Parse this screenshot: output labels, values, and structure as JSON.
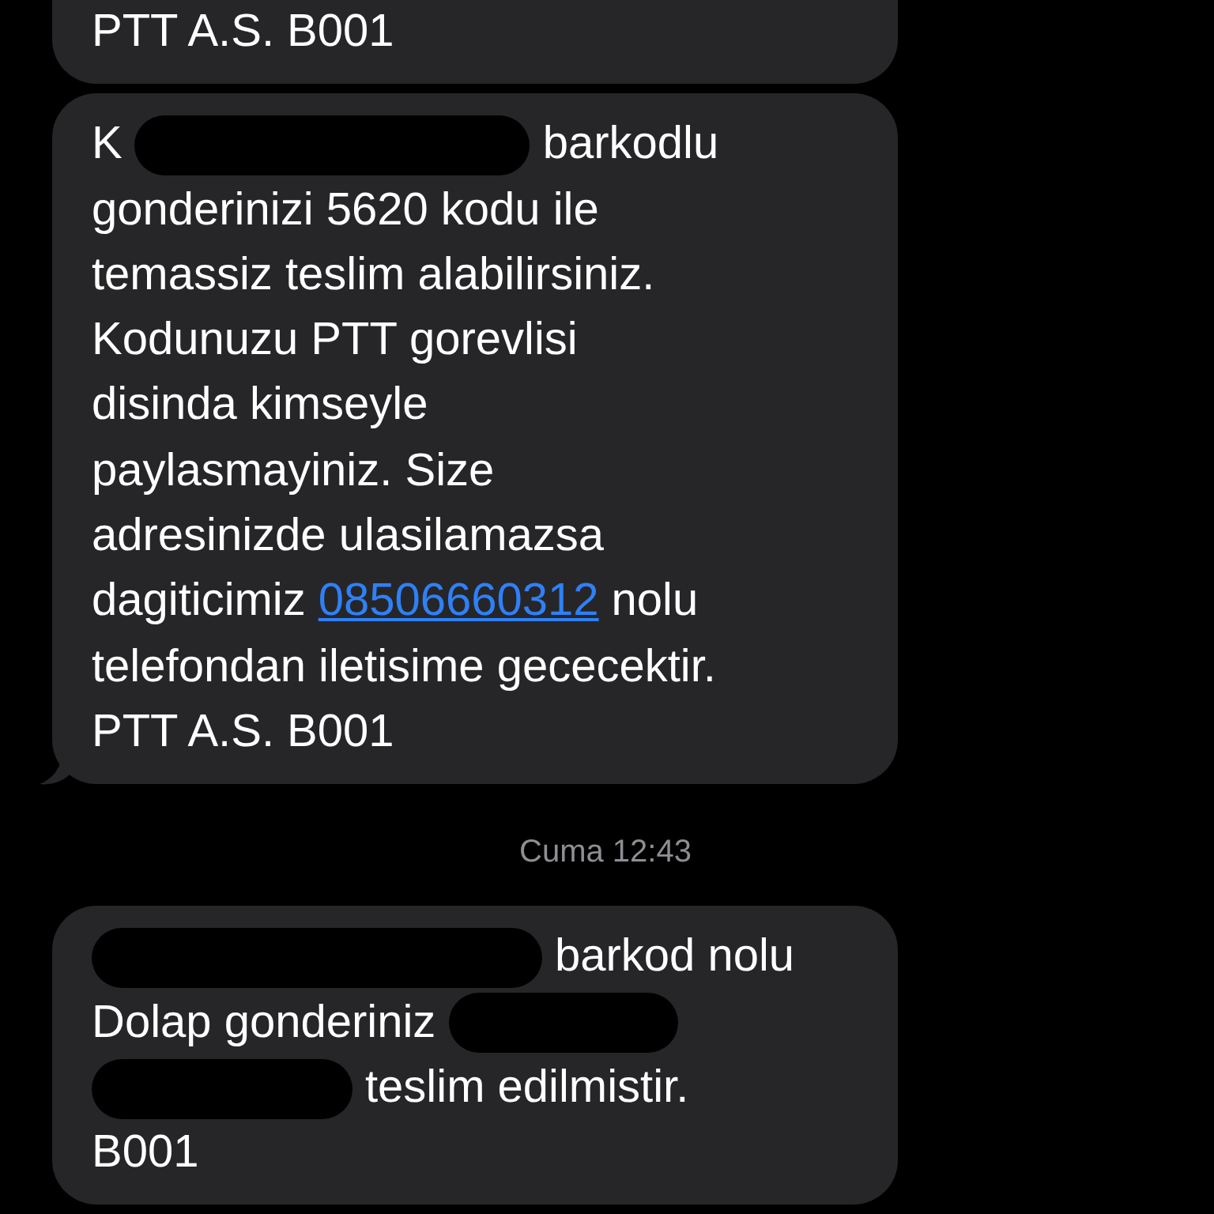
{
  "items": [
    {
      "kind": "message",
      "tail": false,
      "lines": [
        [
          {
            "kind": "text",
            "text": "PTT A.S. B001"
          }
        ]
      ]
    },
    {
      "kind": "message",
      "tail": true,
      "lines": [
        [
          {
            "kind": "text",
            "text": "K"
          },
          {
            "kind": "redacted"
          },
          {
            "kind": "text",
            "text": "barkodlu"
          }
        ],
        [
          {
            "kind": "text",
            "text": "gonderinizi 5620 kodu ile"
          }
        ],
        [
          {
            "kind": "text",
            "text": "temassiz teslim alabilirsiniz."
          }
        ],
        [
          {
            "kind": "text",
            "text": "Kodunuzu PTT gorevlisi"
          }
        ],
        [
          {
            "kind": "text",
            "text": "disinda kimseyle"
          }
        ],
        [
          {
            "kind": "text",
            "text": "paylasmayiniz. Size"
          }
        ],
        [
          {
            "kind": "text",
            "text": "adresinizde ulasilamazsa"
          }
        ],
        [
          {
            "kind": "text",
            "text": "dagiticimiz"
          },
          {
            "kind": "link",
            "text": "08506660312"
          },
          {
            "kind": "text",
            "text": "nolu"
          }
        ],
        [
          {
            "kind": "text",
            "text": "telefondan iletisime gececektir."
          }
        ],
        [
          {
            "kind": "text",
            "text": "PTT A.S. B001"
          }
        ]
      ]
    },
    {
      "kind": "timestamp",
      "text": "Cuma 12:43"
    },
    {
      "kind": "message",
      "tail": false,
      "lines": [
        [
          {
            "kind": "redacted"
          },
          {
            "kind": "text",
            "text": "barkod nolu"
          }
        ],
        [
          {
            "kind": "text",
            "text": "Dolap gonderiniz"
          },
          {
            "kind": "redacted"
          }
        ],
        [
          {
            "kind": "redacted"
          },
          {
            "kind": "text",
            "text": "teslim edilmistir."
          }
        ],
        [
          {
            "kind": "text",
            "text": "B001"
          }
        ]
      ]
    }
  ]
}
